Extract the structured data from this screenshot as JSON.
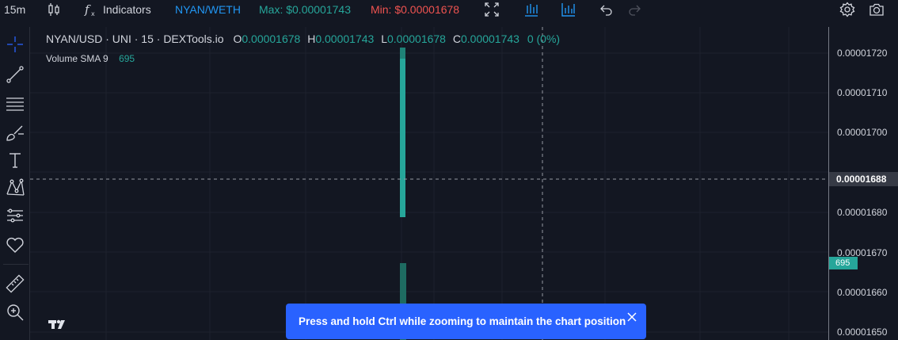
{
  "toolbar": {
    "interval": "15m",
    "indicators_label": "Indicators",
    "pair": "NYAN/WETH",
    "max_label": "Max: $0.00001743",
    "min_label": "Min: $0.00001678",
    "colors": {
      "pair": "#2196f3",
      "max": "#26a69a",
      "min": "#ef5350"
    },
    "icons": [
      "candles-icon",
      "function-icon",
      "fullscreen-icon",
      "bars-chart-icon",
      "line-bars-icon",
      "undo-icon",
      "redo-icon",
      "settings-icon",
      "camera-icon"
    ]
  },
  "left_tools": [
    "crosshair-icon",
    "trend-line-icon",
    "horizontal-lines-icon",
    "brush-icon",
    "text-icon",
    "pattern-icon",
    "prediction-icon",
    "heart-icon",
    "ruler-icon",
    "zoom-icon"
  ],
  "legend": {
    "symbol": "NYAN/USD · UNI · 15 · DEXTools.io",
    "o_label": "O",
    "o_value": "0.00001678",
    "h_label": "H",
    "h_value": "0.00001743",
    "l_label": "L",
    "l_value": "0.00001678",
    "c_label": "C",
    "c_value": "0.00001743",
    "change": "0 (0%)"
  },
  "volume": {
    "label": "Volume SMA 9",
    "value": "695"
  },
  "price_axis": {
    "ticks": [
      "0.00001720",
      "0.00001710",
      "0.00001700",
      "0.00001680",
      "0.00001670",
      "0.00001660",
      "0.00001650"
    ],
    "crosshair_price": "0.00001688",
    "volume_badge": "695"
  },
  "toast": {
    "message": "Press and hold Ctrl while zooming to maintain the chart position"
  },
  "colors": {
    "background": "#131722",
    "up": "#26a69a",
    "accent": "#2962ff"
  }
}
